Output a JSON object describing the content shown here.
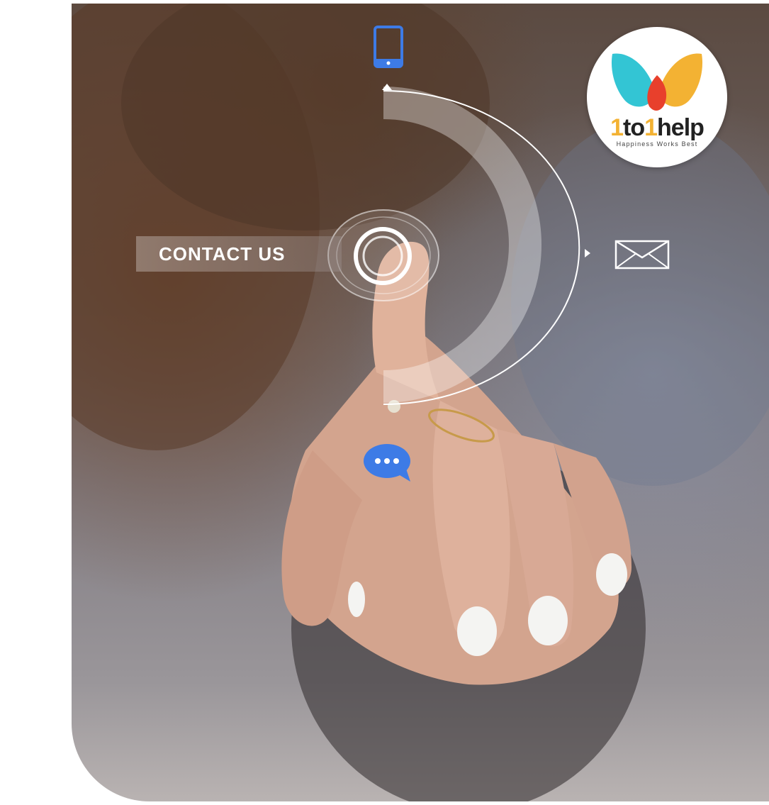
{
  "contact": {
    "label": "CONTACT US"
  },
  "logo": {
    "brand_parts": [
      "1",
      "to",
      "1",
      "help"
    ],
    "tagline": "Happiness Works Best",
    "colors": {
      "left_petal": "#33c5d4",
      "right_petal": "#f3b233",
      "center": "#e8402c"
    }
  },
  "icons": {
    "phone": "tablet-icon",
    "mail": "envelope-icon",
    "chat": "chat-bubble-icon",
    "accent": "#3d7be6"
  }
}
